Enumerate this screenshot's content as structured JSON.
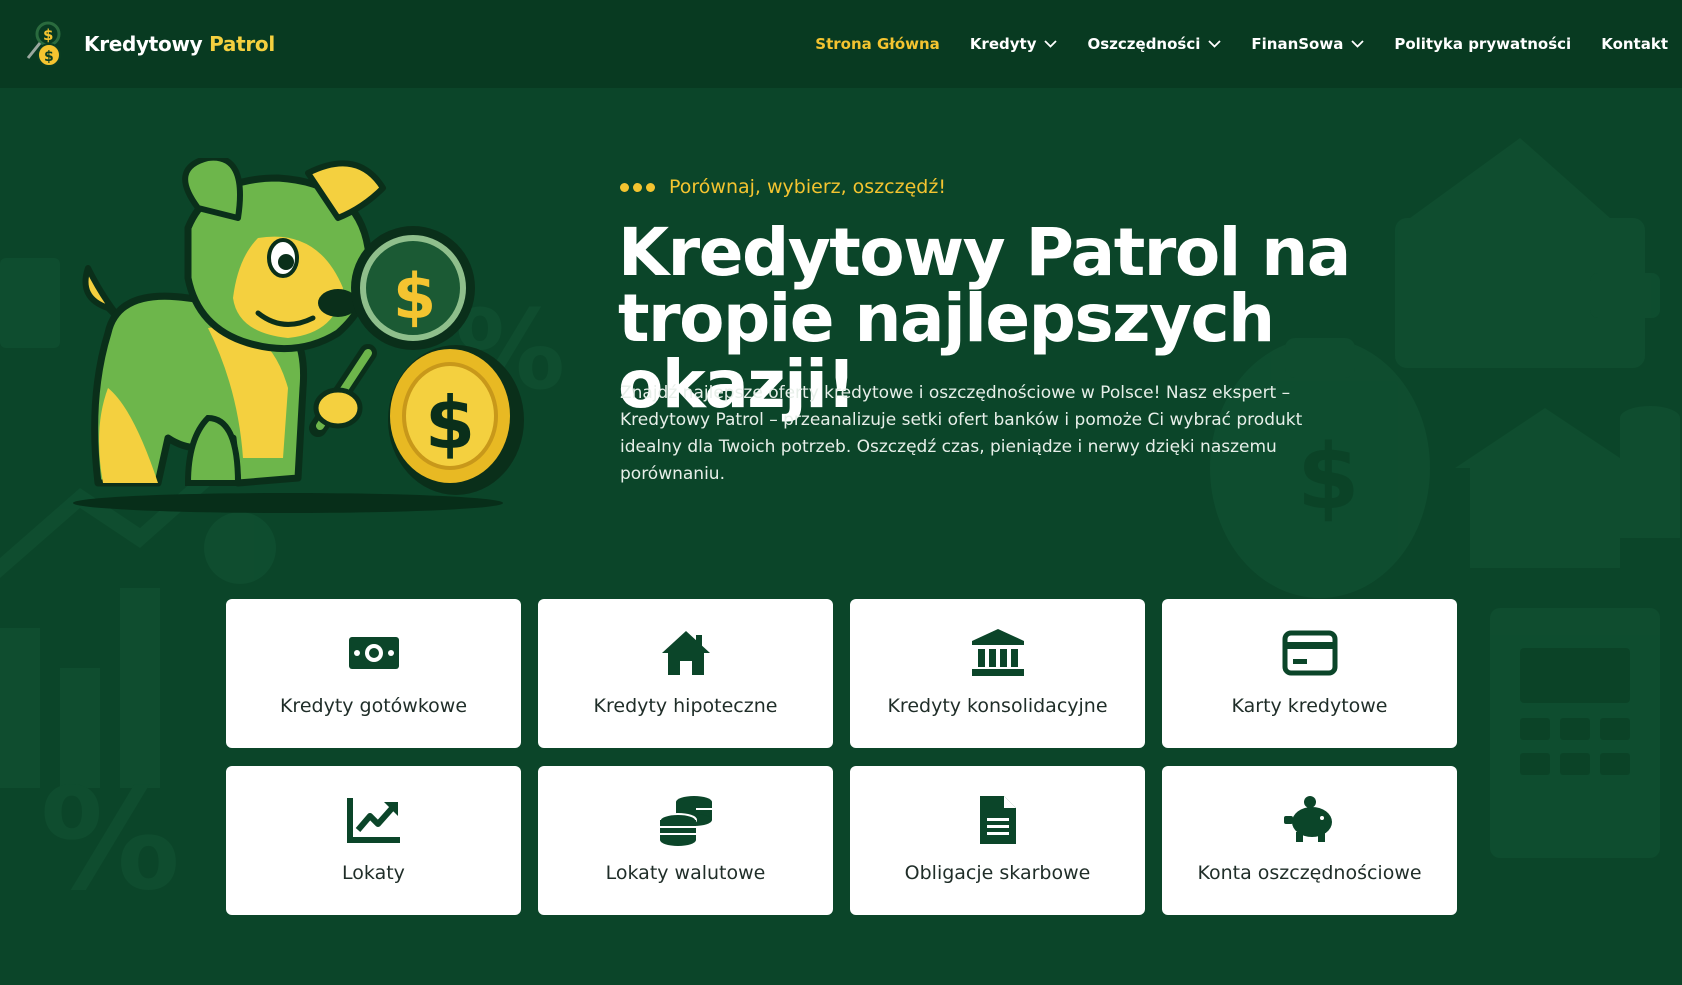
{
  "header": {
    "brand_part1": "Kredytowy",
    "brand_part2": "Patrol",
    "nav": [
      {
        "label": "Strona Główna",
        "active": true,
        "dropdown": false
      },
      {
        "label": "Kredyty",
        "active": false,
        "dropdown": true
      },
      {
        "label": "Oszczędności",
        "active": false,
        "dropdown": true
      },
      {
        "label": "FinanSowa",
        "active": false,
        "dropdown": true
      },
      {
        "label": "Polityka prywatności",
        "active": false,
        "dropdown": false
      },
      {
        "label": "Kontakt",
        "active": false,
        "dropdown": false
      }
    ]
  },
  "hero": {
    "tagline": "Porównaj, wybierz, oszczędź!",
    "headline_line1": "Kredytowy Patrol na",
    "headline_line2": "tropie najlepszych okazji!",
    "lead": "Znajdź najlepsze oferty kredytowe i oszczędnościowe w Polsce! Nasz ekspert – Kredytowy Patrol – przeanalizuje setki ofert banków i pomoże Ci wybrać produkt idealny dla Twoich potrzeb. Oszczędź czas, pieniądze i nerwy dzięki naszemu porównaniu."
  },
  "categories": [
    {
      "label": "Kredyty gotówkowe",
      "icon": "banknote-icon"
    },
    {
      "label": "Kredyty hipoteczne",
      "icon": "house-icon"
    },
    {
      "label": "Kredyty konsolidacyjne",
      "icon": "bank-building-icon"
    },
    {
      "label": "Karty kredytowe",
      "icon": "credit-card-icon"
    },
    {
      "label": "Lokaty",
      "icon": "chart-line-icon"
    },
    {
      "label": "Lokaty walutowe",
      "icon": "coins-icon"
    },
    {
      "label": "Obligacje skarbowe",
      "icon": "document-icon"
    },
    {
      "label": "Konta oszczędnościowe",
      "icon": "piggy-bank-icon"
    }
  ],
  "colors": {
    "background": "#0b4529",
    "header": "#083a21",
    "accent": "#f4c430",
    "icon": "#0b4529",
    "card": "#ffffff"
  }
}
